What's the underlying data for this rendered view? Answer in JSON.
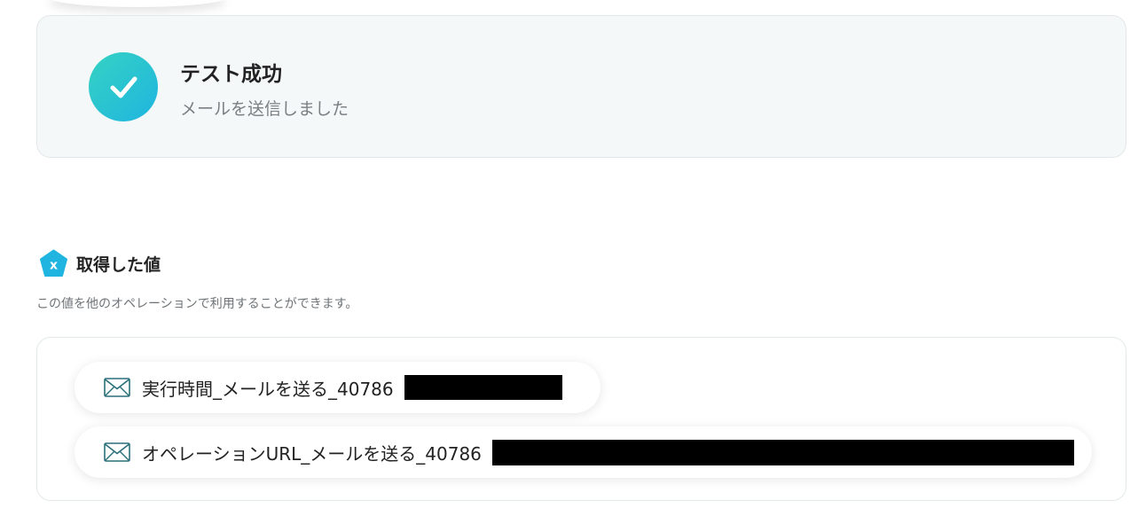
{
  "status": {
    "title": "テスト成功",
    "subtitle": "メールを送信しました",
    "icon": "check-icon",
    "accent_from": "#35d2c3",
    "accent_to": "#1fb5e0"
  },
  "values_section": {
    "title": "取得した値",
    "description": "この値を他のオペレーションで利用することができます。",
    "icon": "variable-badge-icon",
    "items": [
      {
        "label": "実行時間_メールを送る_40786",
        "icon": "mail-icon"
      },
      {
        "label": "オペレーションURL_メールを送る_40786",
        "icon": "mail-icon"
      }
    ]
  }
}
